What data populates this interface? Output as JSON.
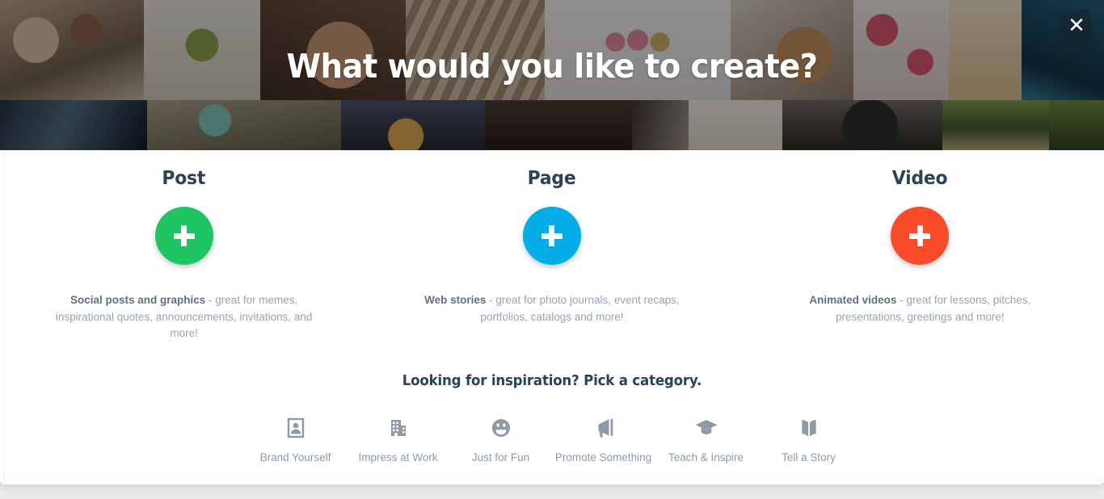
{
  "modal": {
    "hero_title": "What would you like to create?",
    "close_label": "✕"
  },
  "cards": [
    {
      "title": "Post",
      "icon": "plus-icon",
      "color": "#1ec562",
      "desc_bold": "Social posts and graphics",
      "desc_rest": " - great for memes, inspirational quotes, announcements, invitations, and more!"
    },
    {
      "title": "Page",
      "icon": "plus-icon",
      "color": "#03aee8",
      "desc_bold": "Web stories",
      "desc_rest": " - great for photo journals, event recaps, portfolios, catalogs and more!"
    },
    {
      "title": "Video",
      "icon": "plus-icon",
      "color": "#fa4b2a",
      "desc_bold": "Animated videos",
      "desc_rest": " - great for lessons, pitches, presentations, greetings and more!"
    }
  ],
  "inspiration": {
    "title": "Looking for inspiration? Pick a category.",
    "categories": [
      {
        "label": "Brand Yourself",
        "icon": "portrait-card-icon"
      },
      {
        "label": "Impress at Work",
        "icon": "office-building-icon"
      },
      {
        "label": "Just for Fun",
        "icon": "smiley-face-icon"
      },
      {
        "label": "Promote Something",
        "icon": "megaphone-icon"
      },
      {
        "label": "Teach & Inspire",
        "icon": "graduation-cap-icon"
      },
      {
        "label": "Tell a Story",
        "icon": "open-book-icon"
      }
    ]
  },
  "colors": {
    "heading": "#2d4159",
    "body_text": "#98a4b0",
    "body_text_bold": "#62707e",
    "icon": "#8d9aa7",
    "post_accent": "#1ec562",
    "page_accent": "#03aee8",
    "video_accent": "#fa4b2a"
  }
}
